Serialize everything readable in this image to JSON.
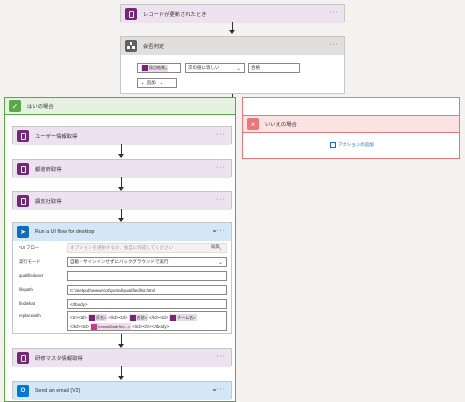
{
  "trigger": {
    "title": "レコードが更新されたとき"
  },
  "condition": {
    "title": "会否判定",
    "left_chip": "採点結果",
    "operator": "次の値に等しい",
    "right_value": "合格",
    "add_label": "追加"
  },
  "branch_yes": {
    "title": "はいの場合"
  },
  "branch_no": {
    "title": "いいえの場合",
    "add_action": "アクションの追加"
  },
  "actions": [
    {
      "title": "ユーザー情報取得"
    },
    {
      "title": "都道府取得"
    },
    {
      "title": "講支社取得"
    }
  ],
  "uiflow": {
    "title": "Run a UI flow for desktop",
    "fields": [
      {
        "label": "*UI フロー",
        "value": "オプションを選択するか、独自に作成してください",
        "button": "編集"
      },
      {
        "label": "実行モード",
        "value": "自動 - サインインせずにバックグラウンドで実行"
      },
      {
        "label": "qualifieduser",
        "value": ""
      },
      {
        "label": "filepath",
        "value": "C:\\inetpub\\wwwroot\\portal\\qualifiedlist.html"
      },
      {
        "label": "findwhat",
        "value": "</tbody>"
      },
      {
        "label": "replacewith",
        "line1_prefix": "<tr><td>",
        "chip1": "氏名",
        "line1_mid": "</td><td>",
        "chip2": "名前",
        "line1_mid2": "</td><td>",
        "chip3": "チーム名",
        "line2_prefix": "</td><td>",
        "chip4": "formatDateTim...",
        "line2_suffix": "</td></tr></tbody>"
      }
    ]
  },
  "master": {
    "title": "研修マスタ情報取得"
  },
  "email": {
    "title": "Send an email (V2)"
  },
  "colors": {
    "purple": "#742774",
    "blue": "#0f6cbd",
    "green": "#5aa846",
    "pink": "#e8777a"
  }
}
